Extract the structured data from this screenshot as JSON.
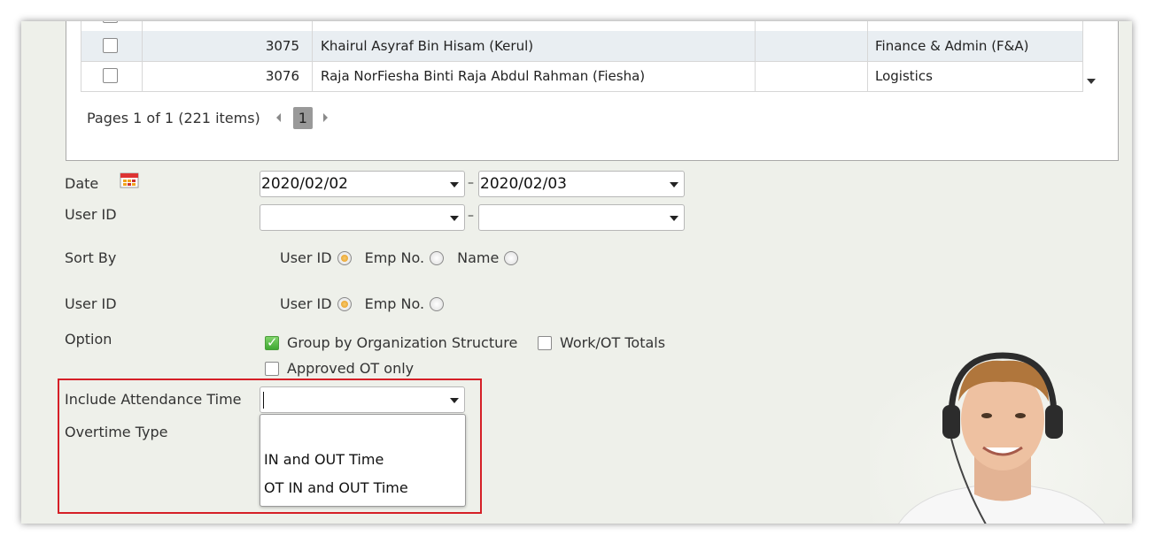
{
  "grid": {
    "rows": [
      {
        "id": "3075",
        "name": "Khairul Asyraf Bin Hisam (Kerul)",
        "dept": "Finance & Admin (F&A)"
      },
      {
        "id": "3076",
        "name": "Raja NorFiesha Binti Raja Abdul Rahman (Fiesha)",
        "dept": "Logistics"
      }
    ],
    "pager_text": "Pages 1 of 1 (221 items)",
    "current_page": "1"
  },
  "form": {
    "date_label": "Date",
    "date_from": "2020/02/02",
    "date_to": "2020/02/03",
    "userid_range_label": "User ID",
    "userid_from": "",
    "userid_to": "",
    "sortby_label": "Sort By",
    "sortby_options": [
      "User ID",
      "Emp No.",
      "Name"
    ],
    "sortby_selected": "User ID",
    "userid_label": "User ID",
    "userid_options": [
      "User ID",
      "Emp No."
    ],
    "userid_selected": "User ID",
    "option_label": "Option",
    "option_group_by_org": "Group by Organization Structure",
    "option_group_by_org_checked": true,
    "option_work_ot_totals": "Work/OT Totals",
    "option_work_ot_totals_checked": false,
    "option_approved_ot": "Approved OT only",
    "option_approved_ot_checked": false,
    "include_attendance_label": "Include Attendance Time",
    "include_attendance_value": "",
    "overtime_type_label": "Overtime Type",
    "dropdown_options": [
      "",
      "IN and OUT Time",
      "OT IN and OUT Time"
    ]
  },
  "colors": {
    "highlight": "#d51f27",
    "background": "#eef0ea",
    "radio_selected": "#e59a21",
    "checkbox_checked": "#3fa832"
  },
  "icons": {
    "calendar": "calendar-icon",
    "caret": "chevron-down-icon"
  }
}
